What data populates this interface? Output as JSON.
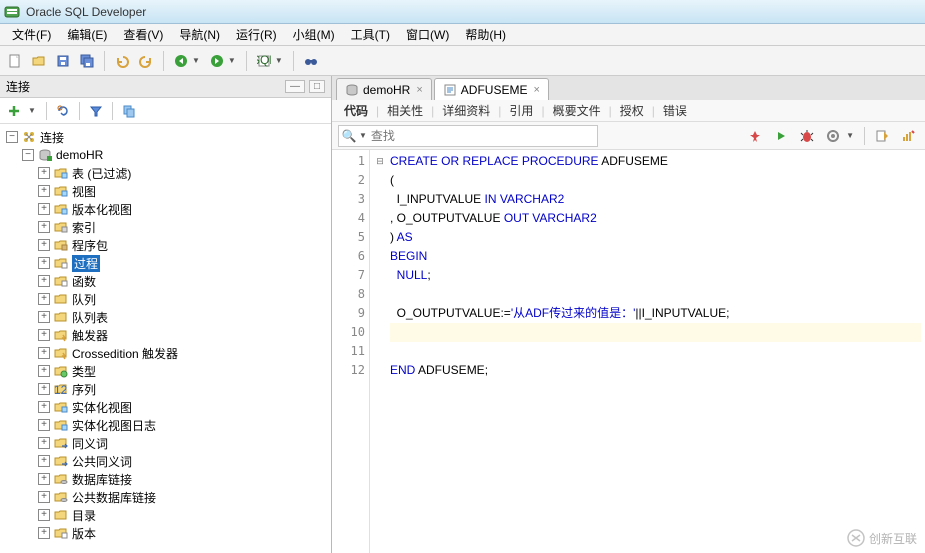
{
  "window": {
    "title": "Oracle SQL Developer"
  },
  "menu": {
    "file": "文件(F)",
    "edit": "编辑(E)",
    "view": "查看(V)",
    "navigate": "导航(N)",
    "run": "运行(R)",
    "group": "小组(M)",
    "tools": "工具(T)",
    "window": "窗口(W)",
    "help": "帮助(H)"
  },
  "sidebar": {
    "title": "连接",
    "root": "连接",
    "connection": "demoHR",
    "items": {
      "tables": "表 (已过滤)",
      "views": "视图",
      "editioning_views": "版本化视图",
      "indexes": "索引",
      "packages": "程序包",
      "procedures": "过程",
      "functions": "函数",
      "queues": "队列",
      "queue_tables": "队列表",
      "triggers": "触发器",
      "crossedition": "Crossedition 触发器",
      "types": "类型",
      "sequences": "序列",
      "mviews": "实体化视图",
      "mview_logs": "实体化视图日志",
      "synonyms": "同义词",
      "public_synonyms": "公共同义词",
      "dblinks": "数据库链接",
      "public_dblinks": "公共数据库链接",
      "directories": "目录",
      "editions": "版本"
    }
  },
  "tabs": {
    "connection_tab": "demoHR",
    "proc_tab": "ADFUSEME"
  },
  "subtabs": {
    "code": "代码",
    "dependencies": "相关性",
    "details": "详细资料",
    "references": "引用",
    "profiles": "概要文件",
    "grants": "授权",
    "errors": "错误"
  },
  "search": {
    "placeholder": "查找"
  },
  "code_lines": {
    "l1_a": "CREATE",
    "l1_b": "OR",
    "l1_c": "REPLACE",
    "l1_d": "PROCEDURE",
    "l1_e": "ADFUSEME",
    "l2": "(",
    "l3_a": "  I_INPUTVALUE",
    "l3_b": "IN",
    "l3_c": "VARCHAR2",
    "l4_a": ", O_OUTPUTVALUE",
    "l4_b": "OUT",
    "l4_c": "VARCHAR2",
    "l5_a": ")",
    "l5_b": "AS",
    "l6": "BEGIN",
    "l7_a": "  ",
    "l7_b": "NULL",
    "l7_c": ";",
    "l8": "",
    "l9_a": "  O_OUTPUTVALUE:=",
    "l9_b": "'从ADF传过来的值是：'",
    "l9_c": "||I_INPUTVALUE;",
    "l10": "",
    "l11": "",
    "l12_a": "END",
    "l12_b": "ADFUSEME;"
  },
  "line_numbers": [
    "1",
    "2",
    "3",
    "4",
    "5",
    "6",
    "7",
    "8",
    "9",
    "10",
    "11",
    "12"
  ],
  "watermark": "创新互联"
}
